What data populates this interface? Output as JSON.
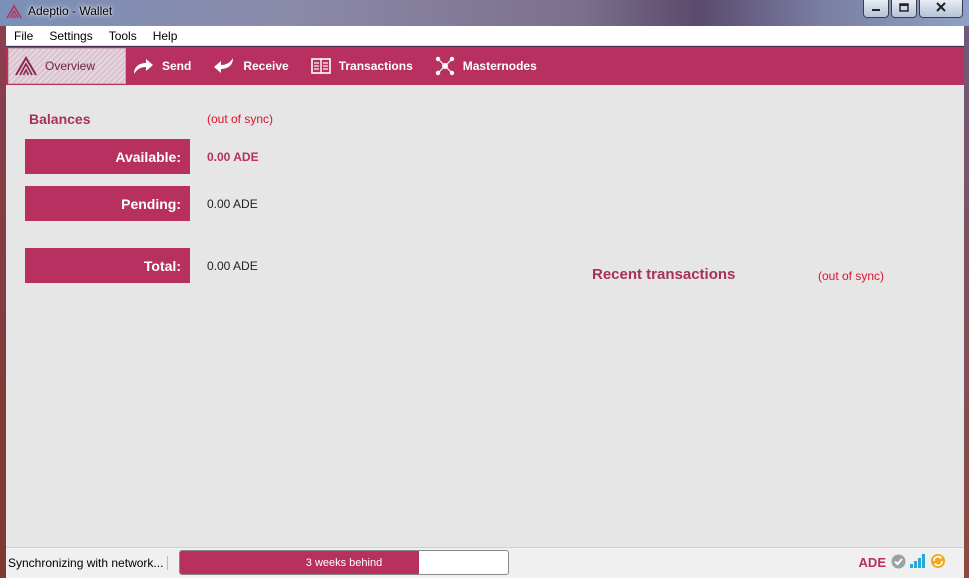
{
  "window": {
    "title": "Adeptio - Wallet"
  },
  "menu": {
    "items": [
      "File",
      "Settings",
      "Tools",
      "Help"
    ]
  },
  "toolbar": {
    "tabs": [
      {
        "label": "Overview",
        "icon": "adeptio-logo-icon"
      },
      {
        "label": "Send",
        "icon": "send-arrow-icon"
      },
      {
        "label": "Receive",
        "icon": "receive-arrow-icon"
      },
      {
        "label": "Transactions",
        "icon": "transactions-icon"
      },
      {
        "label": "Masternodes",
        "icon": "masternodes-icon"
      }
    ]
  },
  "balances": {
    "title": "Balances",
    "sync_status": "(out of sync)",
    "available_label": "Available:",
    "available_value": "0.00 ADE",
    "pending_label": "Pending:",
    "pending_value": "0.00 ADE",
    "total_label": "Total:",
    "total_value": "0.00 ADE"
  },
  "recent": {
    "title": "Recent transactions",
    "sync_status": "(out of sync)"
  },
  "status": {
    "text": "Synchronizing with network...",
    "progress_label": "3 weeks behind",
    "progress_fraction": 0.73,
    "unit": "ADE"
  },
  "colors": {
    "accent": "#b7305f",
    "warning": "#e0102c",
    "background": "#e6e6e6"
  }
}
